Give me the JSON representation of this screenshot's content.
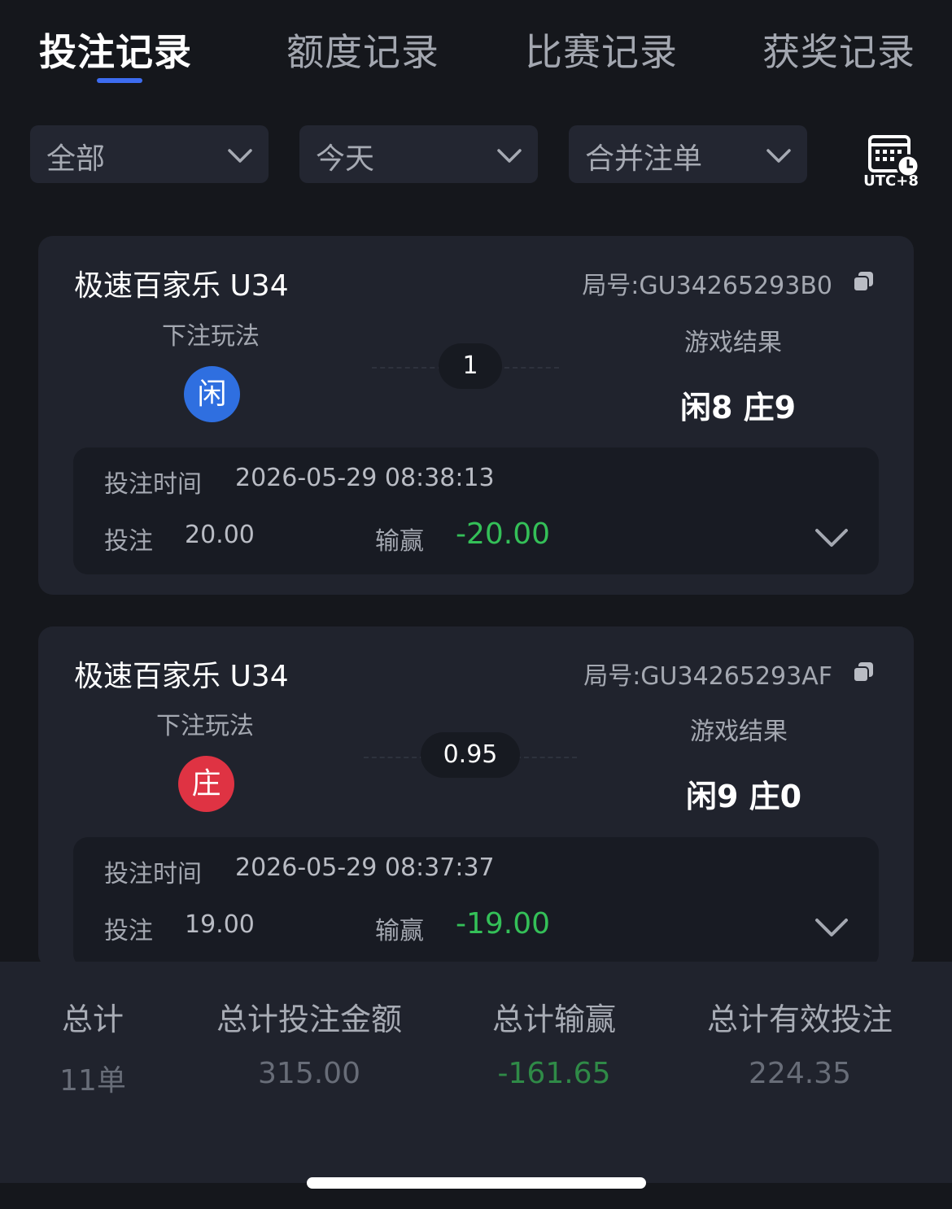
{
  "tabs": [
    {
      "label": "投注记录",
      "active": true
    },
    {
      "label": "额度记录",
      "active": false
    },
    {
      "label": "比赛记录",
      "active": false
    },
    {
      "label": "获奖记录",
      "active": false
    }
  ],
  "filters": {
    "category": "全部",
    "date": "今天",
    "merge": "合并注单",
    "timezone": "UTC+8"
  },
  "records": [
    {
      "game": "极速百家乐 U34",
      "round": "局号:GU34265293B0",
      "bet_type_label": "下注玩法",
      "bet_choice": "闲",
      "odds": "1",
      "result_label": "游戏结果",
      "result": "闲8 庄9",
      "time_label": "投注时间",
      "time": "2026-05-29 08:38:13",
      "stake_label": "投注",
      "stake": "20.00",
      "winloss_label": "输赢",
      "winloss": "-20.00"
    },
    {
      "game": "极速百家乐 U34",
      "round": "局号:GU34265293AF",
      "bet_type_label": "下注玩法",
      "bet_choice": "庄",
      "odds": "0.95",
      "result_label": "游戏结果",
      "result": "闲9 庄0",
      "time_label": "投注时间",
      "time": "2026-05-29 08:37:37",
      "stake_label": "投注",
      "stake": "19.00",
      "winloss_label": "输赢",
      "winloss": "-19.00"
    }
  ],
  "summary": {
    "count_label": "总计",
    "count": "11单",
    "total_bet_label": "总计投注金额",
    "total_bet": "315.00",
    "total_winloss_label": "总计输赢",
    "total_winloss": "-161.65",
    "valid_bet_label": "总计有效投注",
    "valid_bet": "224.35"
  },
  "colors": {
    "background": "#15171c",
    "card": "#20232d",
    "accent": "#3d6cf0",
    "player": "#2f6fe0",
    "banker": "#df3343",
    "win_loss_green": "#34c058"
  }
}
